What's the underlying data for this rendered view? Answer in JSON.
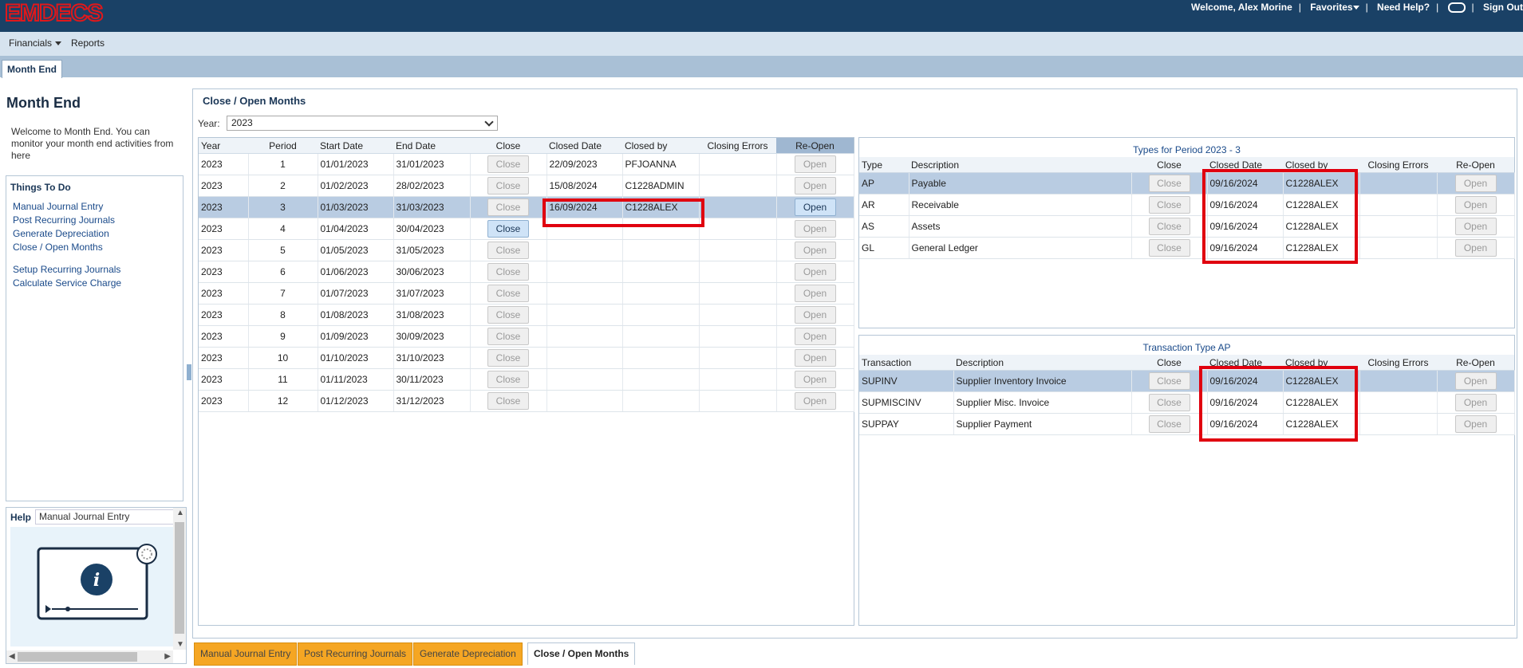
{
  "app": {
    "logo": "EMDECS"
  },
  "topnav": {
    "welcome": "Welcome, Alex Morine",
    "favorites": "Favorites",
    "help": "Need Help?",
    "signout": "Sign Out"
  },
  "menu": {
    "financials": "Financials",
    "reports": "Reports"
  },
  "page_tab": "Month End",
  "sidebar": {
    "title": "Month End",
    "welcome": "Welcome to Month End. You can monitor your month end activities from here",
    "things_title": "Things To Do",
    "links": [
      "Manual Journal Entry",
      "Post Recurring Journals",
      "Generate Depreciation",
      "Close / Open Months",
      "Setup Recurring Journals",
      "Calculate Service Charge"
    ],
    "help_label": "Help",
    "help_topic": "Manual Journal Entry"
  },
  "main": {
    "title": "Close / Open Months",
    "year_label": "Year:",
    "year_value": "2023"
  },
  "periods": {
    "headers": [
      "Year",
      "Period",
      "Start Date",
      "End Date",
      "Close",
      "Closed Date",
      "Closed by",
      "Closing Errors",
      "Re-Open"
    ],
    "close_label": "Close",
    "open_label": "Open",
    "rows": [
      {
        "year": "2023",
        "period": "1",
        "start": "01/01/2023",
        "end": "31/01/2023",
        "closed_date": "22/09/2023",
        "closed_by": "PFJOANNA",
        "errors": ""
      },
      {
        "year": "2023",
        "period": "2",
        "start": "01/02/2023",
        "end": "28/02/2023",
        "closed_date": "15/08/2024",
        "closed_by": "C1228ADMIN",
        "errors": ""
      },
      {
        "year": "2023",
        "period": "3",
        "start": "01/03/2023",
        "end": "31/03/2023",
        "closed_date": "16/09/2024",
        "closed_by": "C1228ALEX",
        "errors": ""
      },
      {
        "year": "2023",
        "period": "4",
        "start": "01/04/2023",
        "end": "30/04/2023",
        "closed_date": "",
        "closed_by": "",
        "errors": ""
      },
      {
        "year": "2023",
        "period": "5",
        "start": "01/05/2023",
        "end": "31/05/2023",
        "closed_date": "",
        "closed_by": "",
        "errors": ""
      },
      {
        "year": "2023",
        "period": "6",
        "start": "01/06/2023",
        "end": "30/06/2023",
        "closed_date": "",
        "closed_by": "",
        "errors": ""
      },
      {
        "year": "2023",
        "period": "7",
        "start": "01/07/2023",
        "end": "31/07/2023",
        "closed_date": "",
        "closed_by": "",
        "errors": ""
      },
      {
        "year": "2023",
        "period": "8",
        "start": "01/08/2023",
        "end": "31/08/2023",
        "closed_date": "",
        "closed_by": "",
        "errors": ""
      },
      {
        "year": "2023",
        "period": "9",
        "start": "01/09/2023",
        "end": "30/09/2023",
        "closed_date": "",
        "closed_by": "",
        "errors": ""
      },
      {
        "year": "2023",
        "period": "10",
        "start": "01/10/2023",
        "end": "31/10/2023",
        "closed_date": "",
        "closed_by": "",
        "errors": ""
      },
      {
        "year": "2023",
        "period": "11",
        "start": "01/11/2023",
        "end": "30/11/2023",
        "closed_date": "",
        "closed_by": "",
        "errors": ""
      },
      {
        "year": "2023",
        "period": "12",
        "start": "01/12/2023",
        "end": "31/12/2023",
        "closed_date": "",
        "closed_by": "",
        "errors": ""
      }
    ]
  },
  "types": {
    "title": "Types for Period 2023 - 3",
    "headers": [
      "Type",
      "Description",
      "Close",
      "Closed Date",
      "Closed by",
      "Closing Errors",
      "Re-Open"
    ],
    "rows": [
      {
        "type": "AP",
        "desc": "Payable",
        "closed_date": "09/16/2024",
        "closed_by": "C1228ALEX",
        "errors": ""
      },
      {
        "type": "AR",
        "desc": "Receivable",
        "closed_date": "09/16/2024",
        "closed_by": "C1228ALEX",
        "errors": ""
      },
      {
        "type": "AS",
        "desc": "Assets",
        "closed_date": "09/16/2024",
        "closed_by": "C1228ALEX",
        "errors": ""
      },
      {
        "type": "GL",
        "desc": "General Ledger",
        "closed_date": "09/16/2024",
        "closed_by": "C1228ALEX",
        "errors": ""
      }
    ]
  },
  "transactions": {
    "title": "Transaction Type AP",
    "headers": [
      "Transaction",
      "Description",
      "Close",
      "Closed Date",
      "Closed by",
      "Closing Errors",
      "Re-Open"
    ],
    "rows": [
      {
        "code": "SUPINV",
        "desc": "Supplier Inventory Invoice",
        "closed_date": "09/16/2024",
        "closed_by": "C1228ALEX",
        "errors": ""
      },
      {
        "code": "SUPMISCINV",
        "desc": "Supplier Misc. Invoice",
        "closed_date": "09/16/2024",
        "closed_by": "C1228ALEX",
        "errors": ""
      },
      {
        "code": "SUPPAY",
        "desc": "Supplier Payment",
        "closed_date": "09/16/2024",
        "closed_by": "C1228ALEX",
        "errors": ""
      }
    ]
  },
  "bottom_tabs": [
    "Manual Journal Entry",
    "Post Recurring Journals",
    "Generate Depreciation",
    "Close / Open Months"
  ],
  "colors": {
    "header": "#1a4166",
    "selected_row": "#b9cce2",
    "highlight": "#e0000f",
    "tab_orange": "#f5a623"
  }
}
